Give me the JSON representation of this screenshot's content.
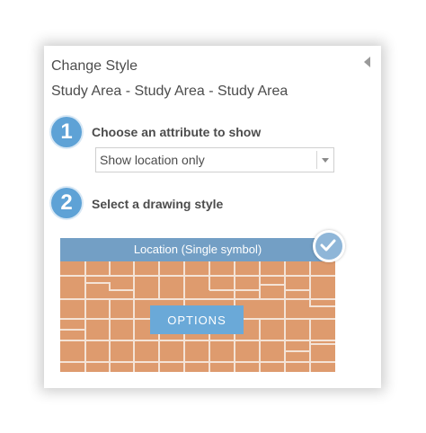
{
  "panel": {
    "title": "Change Style",
    "subtitle": "Study Area - Study Area - Study Area"
  },
  "steps": [
    {
      "number": "1",
      "label": "Choose an attribute to show"
    },
    {
      "number": "2",
      "label": "Select a drawing style"
    }
  ],
  "attribute_select": {
    "selected": "Show location only"
  },
  "drawing_style": {
    "header_label": "Location (Single symbol)",
    "options_label": "OPTIONS",
    "selected": true
  },
  "colors": {
    "accent": "#5ea2d6",
    "fill": "#de9b6e",
    "header": "#69a0cc",
    "text": "#4c4c4c"
  },
  "icons": {
    "collapse": "triangle-left-icon",
    "dropdown": "chevron-down-icon",
    "selected": "check-icon"
  }
}
